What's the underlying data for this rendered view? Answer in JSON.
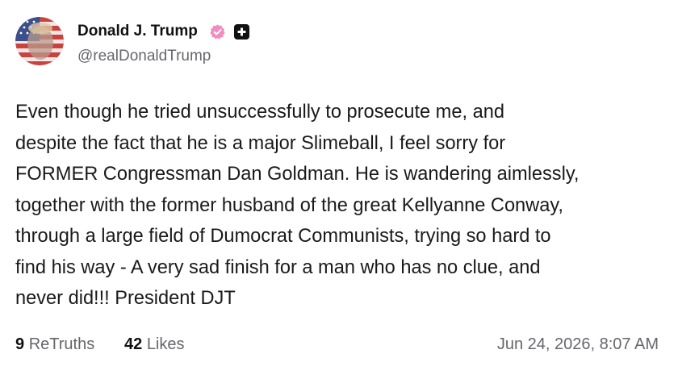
{
  "post": {
    "author_name": "Donald J. Trump",
    "handle": "@realDonaldTrump",
    "icons": {
      "verified": "verified-badge-icon",
      "plus": "plus-icon"
    },
    "colors": {
      "verified_badge": "#f08ebf",
      "text": "#1a1a1a",
      "muted": "#66666d"
    },
    "body_lines": [
      "Even though he tried unsuccessfully to prosecute me, and",
      "despite the fact that he is a major Slimeball, I feel sorry for",
      "FORMER Congressman Dan Goldman. He is wandering aimlessly,",
      "together with the former husband of the great Kellyanne Conway,",
      "through a large field of Dumocrat Communists, trying so hard to",
      "find his way - A very sad finish for a man who has no clue, and",
      "never did!!! President DJT"
    ],
    "retruths_count": "9",
    "retruths_label": "ReTruths",
    "likes_count": "42",
    "likes_label": "Likes",
    "timestamp": "Jun 24, 2026, 8:07 AM"
  }
}
